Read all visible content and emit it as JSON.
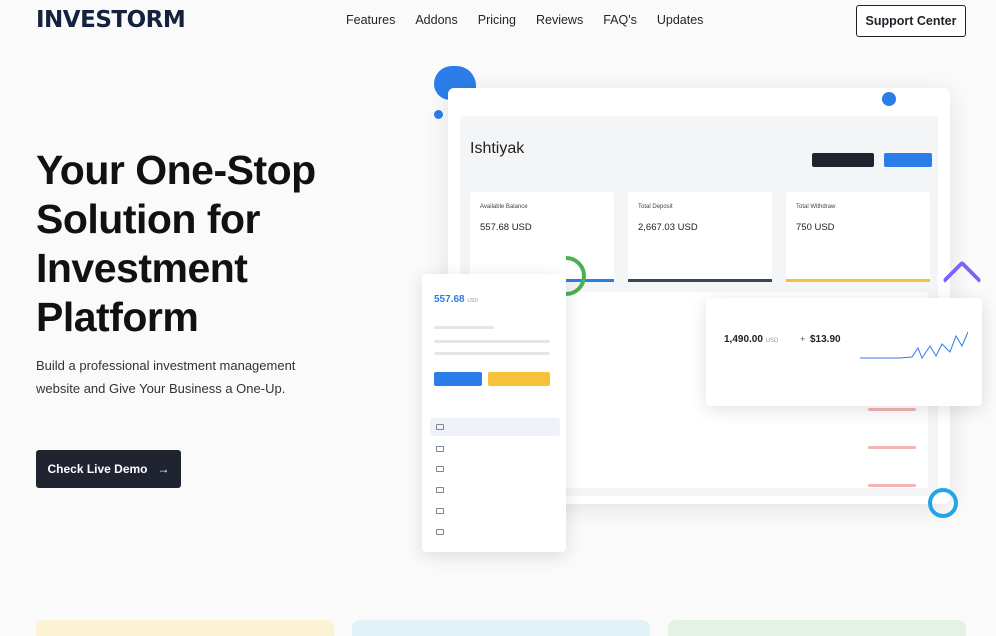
{
  "brand": {
    "logo": "INVESTORM"
  },
  "nav": {
    "items": [
      "Features",
      "Addons",
      "Pricing",
      "Reviews",
      "FAQ's",
      "Updates"
    ],
    "support_label": "Support Center"
  },
  "hero": {
    "title": "Your One-Stop Solution for Investment Platform",
    "subtitle": "Build a professional investment management website and Give Your Business a One-Up.",
    "cta_label": "Check Live Demo",
    "cta_arrow": "→"
  },
  "dashboard": {
    "username": "Ishtiyak",
    "stats": [
      {
        "label": "Available Balance",
        "value": "557.68 USD"
      },
      {
        "label": "Total Deposit",
        "value": "2,667.03 USD"
      },
      {
        "label": "Total Withdraw",
        "value": "750 USD"
      }
    ],
    "side_panel": {
      "balance": "557.68",
      "currency": "USD"
    },
    "invested_card": {
      "value_main": "1,490.00",
      "currency": "USD",
      "plus": "+",
      "value_profit": "$13.90"
    }
  },
  "colors": {
    "accent_blue": "#2b7de9",
    "accent_yellow": "#f5c23a",
    "dark": "#1f2430",
    "feature_strips": [
      "#fbf3d4",
      "#e2f3f7",
      "#e4f2e6"
    ]
  }
}
